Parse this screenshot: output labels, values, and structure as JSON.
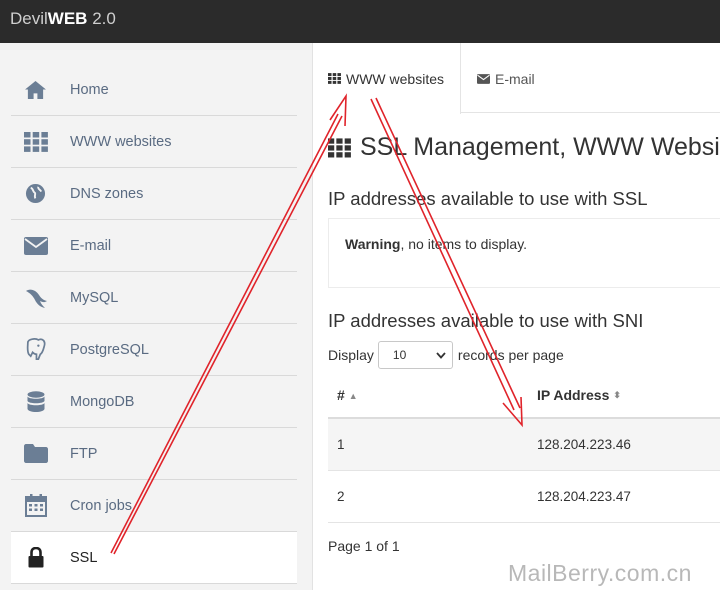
{
  "app": {
    "title_prefix": "Devil",
    "title_brand": "WEB",
    "title_version": " 2.0"
  },
  "sidebar": {
    "items": [
      {
        "label": "Home",
        "icon": "home-icon"
      },
      {
        "label": "WWW websites",
        "icon": "grid-icon"
      },
      {
        "label": "DNS zones",
        "icon": "globe-icon"
      },
      {
        "label": "E-mail",
        "icon": "envelope-icon"
      },
      {
        "label": "MySQL",
        "icon": "dolphin-icon"
      },
      {
        "label": "PostgreSQL",
        "icon": "elephant-icon"
      },
      {
        "label": "MongoDB",
        "icon": "database-icon"
      },
      {
        "label": "FTP",
        "icon": "folder-icon"
      },
      {
        "label": "Cron jobs",
        "icon": "calendar-icon"
      },
      {
        "label": "SSL",
        "icon": "lock-icon",
        "active": true
      }
    ]
  },
  "tabs": [
    {
      "label": "WWW websites",
      "icon": "grid-icon",
      "active": true
    },
    {
      "label": "E-mail",
      "icon": "envelope-icon",
      "active": false
    }
  ],
  "main": {
    "title": "SSL Management, WWW Websit",
    "ssl_section": {
      "heading": "IP addresses available to use with SSL",
      "warning_label": "Warning",
      "warning_text": ", no items to display."
    },
    "sni_section": {
      "heading": "IP addresses available to use with SNI",
      "display_label": "Display",
      "page_size": "10",
      "records_label": "records per page",
      "columns": [
        "#",
        "IP Address"
      ],
      "rows": [
        {
          "num": "1",
          "ip": "128.204.223.46"
        },
        {
          "num": "2",
          "ip": "128.204.223.47"
        }
      ],
      "pager": "Page 1 of 1"
    }
  },
  "watermark": "MailBerry.com.cn",
  "colors": {
    "topbar": "#2b2b2b",
    "sidebar": "#f3f3f3",
    "annotation_arrow": "#e0242b"
  }
}
